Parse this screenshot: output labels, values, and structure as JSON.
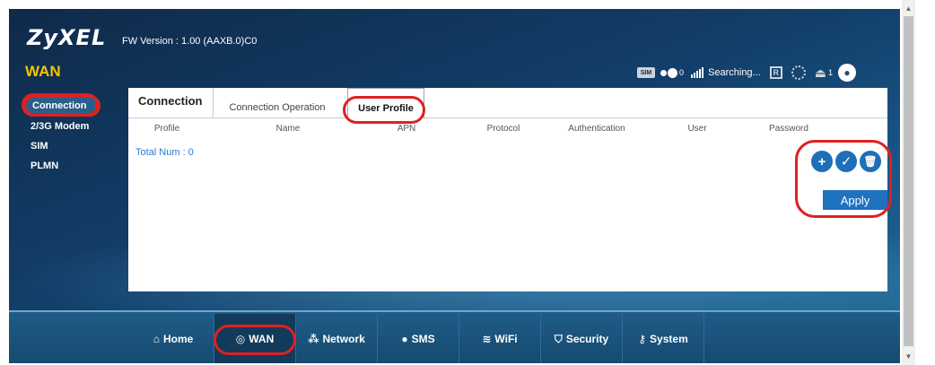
{
  "header": {
    "brand": "ZyXEL",
    "fw_version": "FW Version : 1.00 (AAXB.0)C0",
    "page_title": "WAN"
  },
  "status": {
    "sim": "SIM",
    "message_count": "0",
    "signal_text": "Searching...",
    "r_label": "R",
    "storage_count": "1"
  },
  "sidebar": {
    "items": [
      {
        "label": "Connection",
        "active": true
      },
      {
        "label": "2/3G Modem"
      },
      {
        "label": "SIM"
      },
      {
        "label": "PLMN"
      }
    ]
  },
  "tabs": [
    {
      "label": "Connection"
    },
    {
      "label": "Connection Operation"
    },
    {
      "label": "User Profile",
      "active": true
    }
  ],
  "table": {
    "headers": [
      "Profile",
      "Name",
      "APN",
      "Protocol",
      "Authentication",
      "User",
      "Password"
    ],
    "total": "Total Num : 0"
  },
  "actions": {
    "add": "+",
    "confirm": "✓",
    "delete": "🗑",
    "apply": "Apply"
  },
  "nav": [
    {
      "label": "Home",
      "icon": "home-icon"
    },
    {
      "label": "WAN",
      "icon": "globe-icon",
      "active": true
    },
    {
      "label": "Network",
      "icon": "network-icon"
    },
    {
      "label": "SMS",
      "icon": "sms-icon"
    },
    {
      "label": "WiFi",
      "icon": "wifi-icon"
    },
    {
      "label": "Security",
      "icon": "shield-icon"
    },
    {
      "label": "System",
      "icon": "key-icon"
    }
  ],
  "colors": {
    "accent": "#1e72be",
    "highlight": "#e02020",
    "title": "#f5c400"
  }
}
